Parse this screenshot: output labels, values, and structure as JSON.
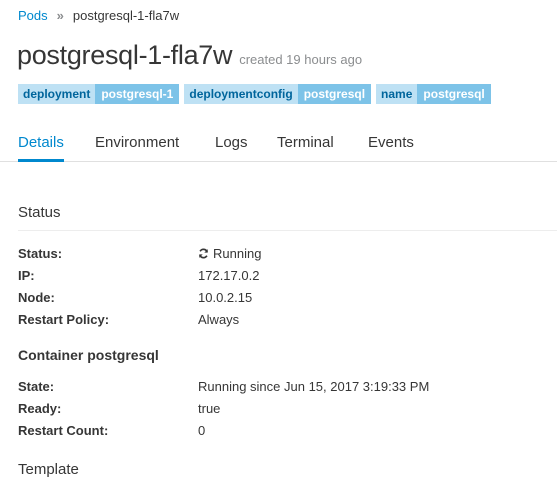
{
  "breadcrumb": {
    "parent_label": "Pods",
    "separator": "»",
    "current_label": "postgresql-1-fla7w"
  },
  "header": {
    "title": "postgresql-1-fla7w",
    "created": "created 19 hours ago"
  },
  "labels": [
    {
      "key": "deployment",
      "value": "postgresql-1"
    },
    {
      "key": "deploymentconfig",
      "value": "postgresql"
    },
    {
      "key": "name",
      "value": "postgresql"
    }
  ],
  "tabs": [
    {
      "label": "Details",
      "active": true
    },
    {
      "label": "Environment",
      "active": false
    },
    {
      "label": "Logs",
      "active": false
    },
    {
      "label": "Terminal",
      "active": false
    },
    {
      "label": "Events",
      "active": false
    }
  ],
  "status_section": {
    "heading": "Status",
    "fields": [
      {
        "label": "Status:",
        "value": "Running",
        "icon": "refresh-icon"
      },
      {
        "label": "IP:",
        "value": "172.17.0.2"
      },
      {
        "label": "Node:",
        "value": "10.0.2.15"
      },
      {
        "label": "Restart Policy:",
        "value": "Always"
      }
    ]
  },
  "container_section": {
    "heading": "Container postgresql",
    "fields": [
      {
        "label": "State:",
        "value": "Running since Jun 15, 2017 3:19:33 PM"
      },
      {
        "label": "Ready:",
        "value": "true"
      },
      {
        "label": "Restart Count:",
        "value": "0"
      }
    ]
  },
  "template_section": {
    "heading": "Template"
  },
  "colors": {
    "link": "#0088ce",
    "label_key_bg": "#bee1f4",
    "label_value_bg": "#7dc3e8",
    "text": "#363636",
    "muted": "#8b8d8f"
  }
}
